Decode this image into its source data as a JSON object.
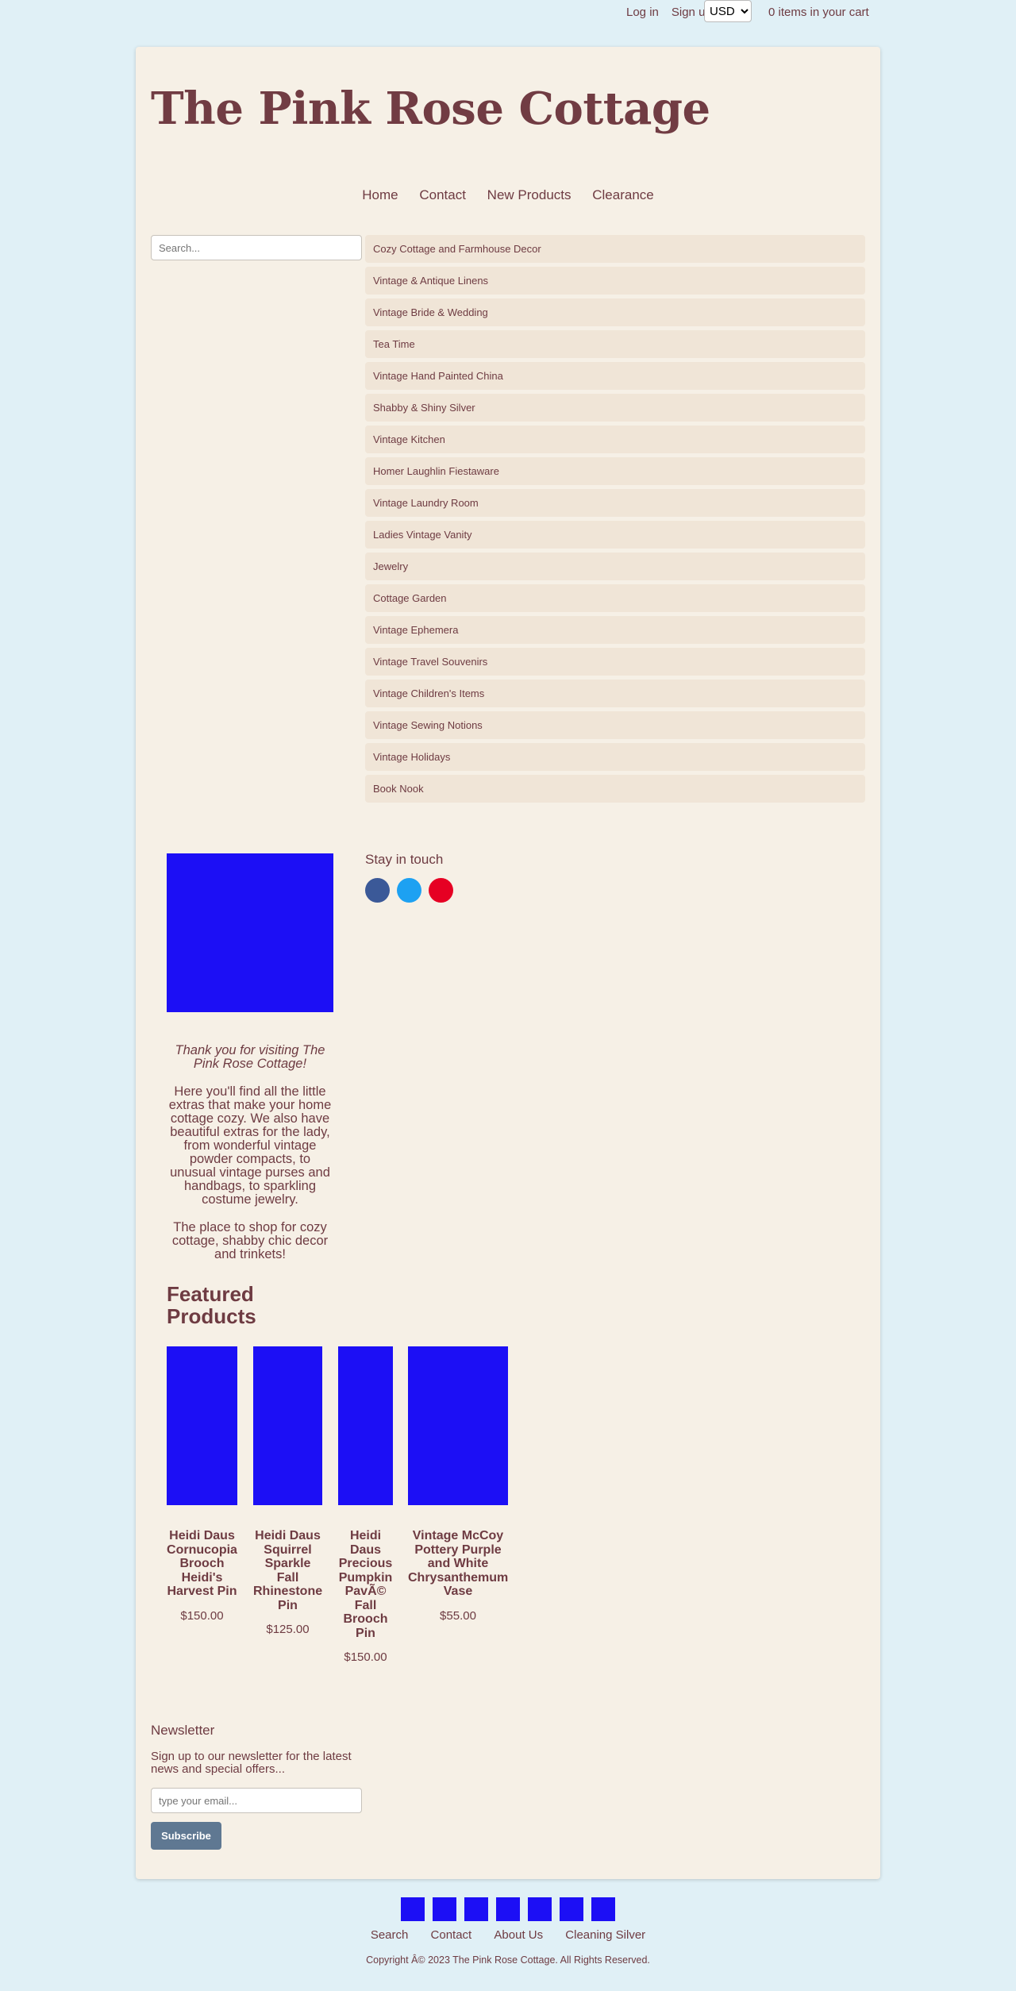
{
  "topbar": {
    "login": "Log in",
    "signup": "Sign up",
    "currency": "USD",
    "cart": "0 items in your cart"
  },
  "site_title": "The Pink Rose Cottage",
  "nav": [
    "Home",
    "Contact",
    "New Products",
    "Clearance"
  ],
  "search": {
    "placeholder": "Search..."
  },
  "categories": [
    "Cozy Cottage and Farmhouse Decor",
    "Vintage & Antique Linens",
    "Vintage Bride & Wedding",
    "Tea Time",
    "Vintage Hand Painted China",
    "Shabby & Shiny Silver",
    "Vintage Kitchen",
    "Homer Laughlin Fiestaware",
    "Vintage Laundry Room",
    "Ladies Vintage Vanity",
    "Jewelry",
    "Cottage Garden",
    "Vintage Ephemera",
    "Vintage Travel Souvenirs",
    "Vintage Children's Items",
    "Vintage Sewing Notions",
    "Vintage Holidays",
    "Book Nook"
  ],
  "stay_in_touch": "Stay in touch",
  "social": [
    {
      "icon": "facebook-icon",
      "color": "#3b5998"
    },
    {
      "icon": "twitter-icon",
      "color": "#1da1f2"
    },
    {
      "icon": "pinterest-icon",
      "color": "#e60023"
    }
  ],
  "welcome": {
    "intro": "Thank you for visiting The Pink Rose Cottage!",
    "body": "Here you'll find all the little extras that make your home cottage cozy. We also have beautiful extras for the lady, from wonderful vintage powder compacts, to unusual vintage purses and handbags, to sparkling costume jewelry.",
    "closing": "The place to shop for cozy cottage, shabby chic decor and trinkets!"
  },
  "featured": {
    "title": "Featured Products",
    "products": [
      {
        "name": "Heidi Daus Cornucopia Brooch Heidi's Harvest Pin",
        "price": "$150.00"
      },
      {
        "name": "Heidi Daus Squirrel Sparkle Fall Rhinestone Pin",
        "price": "$125.00"
      },
      {
        "name": "Heidi Daus Precious Pumpkin PavÃ© Fall Brooch Pin",
        "price": "$150.00"
      },
      {
        "name": "Vintage McCoy Pottery Purple and White Chrysanthemum Vase",
        "price": "$55.00"
      }
    ]
  },
  "newsletter": {
    "title": "Newsletter",
    "text": "Sign up to our newsletter for the latest news and special offers...",
    "placeholder": "type your email...",
    "button": "Subscribe"
  },
  "footer": {
    "links": [
      "Search",
      "Contact",
      "About Us",
      "Cleaning Silver"
    ],
    "copyright": "Copyright Â© 2023 The Pink Rose Cottage. All Rights Reserved."
  },
  "colors": {
    "background": "#e0f0f6",
    "card": "#f6f0e6",
    "text": "#6e3b42",
    "category_bg": "#f0e5d7",
    "placeholder_image": "#1c0ff5",
    "button": "#5f7892"
  }
}
